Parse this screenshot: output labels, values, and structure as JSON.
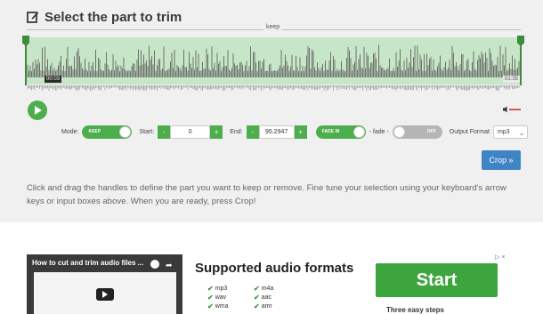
{
  "header": {
    "title": "Select the part to trim",
    "icon": "edit-icon"
  },
  "waveform": {
    "region_label": "keep",
    "start_time": "00:03",
    "end_time": "01:35",
    "region_color": "#c7e5c7",
    "handle_color": "#3d8b3d"
  },
  "controls": {
    "mode_label": "Mode:",
    "mode_toggle": "KEEP",
    "start_label": "Start:",
    "start_value": "0",
    "end_label": "End:",
    "end_value": "95.2947",
    "minus": "-",
    "plus": "+",
    "fade_in_toggle": "FADE IN",
    "fade_separator": "- fade -",
    "fade_out_toggle": "OFF",
    "output_format_label": "Output Format",
    "output_format_value": "mp3"
  },
  "crop_button": "Crop »",
  "help_text": "Click and drag the handles to define the part you want to keep or remove. Fine tune your selection using your keyboard's arrow keys or input boxes above. When you are ready, press Crop!",
  "ad": {
    "video_title": "How to cut and trim audio files ...",
    "formats_title": "Supported audio formats",
    "formats": [
      "mp3",
      "m4a",
      "wav",
      "aac",
      "wma",
      "amr"
    ],
    "marker": "▷ ×",
    "start_button": "Start",
    "start_subtitle": "Three easy steps"
  },
  "colors": {
    "accent_green": "#4cae4c",
    "crop_blue": "#3f85c6"
  }
}
